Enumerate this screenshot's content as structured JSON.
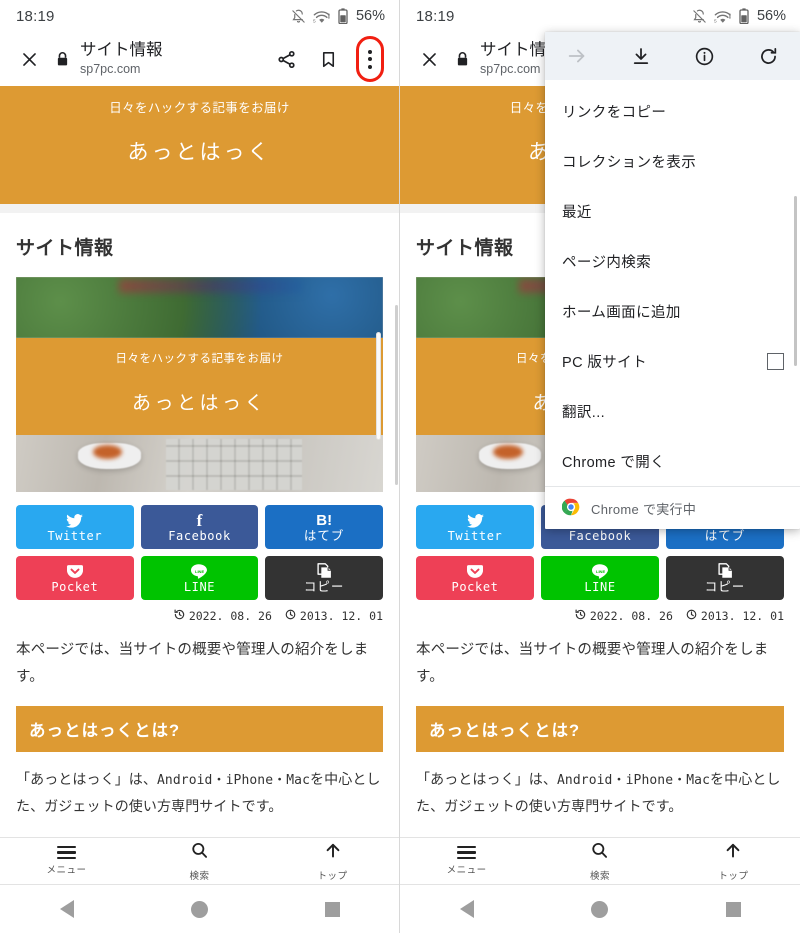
{
  "status_bar": {
    "time": "18:19",
    "battery_percent": "56%",
    "icons": [
      "notifications-off-icon",
      "wifi-5g-icon",
      "battery-icon"
    ]
  },
  "browser_toolbar": {
    "close_label": "×",
    "lock_icon": "lock-icon",
    "title": "サイト情報",
    "url": "sp7pc.com",
    "actions": [
      {
        "name": "share-button",
        "icon": "share-icon"
      },
      {
        "name": "bookmark-button",
        "icon": "bookmark-icon"
      },
      {
        "name": "overflow-menu-button",
        "icon": "three-dots-icon"
      }
    ],
    "annotation_color": "#f11f11"
  },
  "site_hero": {
    "tagline": "日々をハックする記事をお届け",
    "name": "あっとはっく",
    "bg_color": "#dd9a33"
  },
  "page": {
    "title": "サイト情報",
    "embedded_image": {
      "tagline": "日々をハックする記事をお届け",
      "name": "あっとはっく"
    },
    "share_buttons": [
      {
        "name": "share-twitter",
        "label": "Twitter",
        "icon": "twitter-bird-icon",
        "color": "#29a8f0",
        "mono": true
      },
      {
        "name": "share-facebook",
        "label": "Facebook",
        "icon": "facebook-f-icon",
        "color": "#3b5998",
        "mono": true
      },
      {
        "name": "share-hatena",
        "label": "はてブ",
        "icon": "hatena-b-icon",
        "glyph": "B!",
        "color": "#1b6fc4",
        "mono": false
      },
      {
        "name": "share-pocket",
        "label": "Pocket",
        "icon": "pocket-icon",
        "color": "#ee4056",
        "mono": true
      },
      {
        "name": "share-line",
        "label": "LINE",
        "icon": "line-icon",
        "color": "#00c300",
        "mono": true
      },
      {
        "name": "share-copy",
        "label": "コピー",
        "icon": "copy-icon",
        "color": "#333333",
        "mono": false
      }
    ],
    "dates": [
      {
        "name": "updated-date",
        "icon": "history-icon",
        "value": "2022. 08. 26"
      },
      {
        "name": "published-date",
        "icon": "clock-icon",
        "value": "2013. 12. 01"
      }
    ],
    "paragraph1": "本ページでは、当サイトの概要や管理人の紹介をします。",
    "heading2": "あっとはっくとは?",
    "paragraph2_a": "「あっとはっく」は、",
    "paragraph2_mono": "Android・iPhone・Mac",
    "paragraph2_b": "を中心とした、ガジェットの使い方専門サイトです。"
  },
  "site_nav": [
    {
      "name": "site-nav-menu",
      "label": "メニュー",
      "icon": "hamburger-icon"
    },
    {
      "name": "site-nav-search",
      "label": "検索",
      "icon": "search-icon"
    },
    {
      "name": "site-nav-top",
      "label": "トップ",
      "icon": "arrow-up-icon"
    }
  ],
  "system_nav": [
    {
      "name": "android-back-button",
      "icon": "back-triangle-icon"
    },
    {
      "name": "android-home-button",
      "icon": "home-circle-icon"
    },
    {
      "name": "android-recents-button",
      "icon": "recents-square-icon"
    }
  ],
  "overflow_menu": {
    "top_actions": [
      {
        "name": "menu-forward-button",
        "icon": "arrow-forward-icon",
        "disabled": true
      },
      {
        "name": "menu-download-button",
        "icon": "download-icon",
        "disabled": false
      },
      {
        "name": "menu-page-info-button",
        "icon": "info-icon",
        "disabled": false
      },
      {
        "name": "menu-reload-button",
        "icon": "reload-icon",
        "disabled": false
      }
    ],
    "items": [
      {
        "name": "menu-item-copy-link",
        "label": "リンクをコピー",
        "checkbox": false
      },
      {
        "name": "menu-item-show-collections",
        "label": "コレクションを表示",
        "checkbox": false
      },
      {
        "name": "menu-item-recent",
        "label": "最近",
        "checkbox": false
      },
      {
        "name": "menu-item-find-in-page",
        "label": "ページ内検索",
        "checkbox": false
      },
      {
        "name": "menu-item-add-to-home-screen",
        "label": "ホーム画面に追加",
        "checkbox": false
      },
      {
        "name": "menu-item-desktop-site",
        "label": "PC 版サイト",
        "checkbox": true
      },
      {
        "name": "menu-item-translate",
        "label": "翻訳...",
        "checkbox": false
      },
      {
        "name": "menu-item-open-in-chrome",
        "label": "Chrome で開く",
        "checkbox": false
      }
    ],
    "footer": {
      "label": "Chrome で実行中",
      "icon": "chrome-logo-icon"
    }
  }
}
